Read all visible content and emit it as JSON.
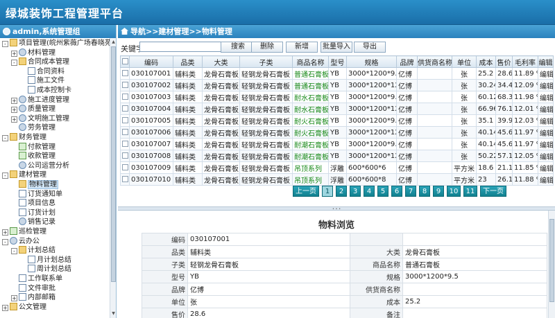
{
  "app": {
    "title": "绿城装饰工程管理平台"
  },
  "sidebar": {
    "user_label": "admin,系统管理组",
    "tree": [
      {
        "label": "项目管理(皖州紫薇广场春晓苑...",
        "level": 0,
        "tog": "-",
        "icon": "folder"
      },
      {
        "label": "材料管理",
        "level": 1,
        "tog": "+",
        "icon": "gear"
      },
      {
        "label": "合同成本管理",
        "level": 1,
        "tog": "-",
        "icon": "folder"
      },
      {
        "label": "合同资料",
        "level": 2,
        "tog": "",
        "icon": "doc"
      },
      {
        "label": "施工文件",
        "level": 2,
        "tog": "",
        "icon": "doc"
      },
      {
        "label": "成本控制卡",
        "level": 2,
        "tog": "",
        "icon": "doc"
      },
      {
        "label": "施工进度管理",
        "level": 1,
        "tog": "+",
        "icon": "gear"
      },
      {
        "label": "质量管理",
        "level": 1,
        "tog": "+",
        "icon": "gear"
      },
      {
        "label": "文明施工管理",
        "level": 1,
        "tog": "+",
        "icon": "gear"
      },
      {
        "label": "劳务管理",
        "level": 1,
        "tog": "",
        "icon": "gear"
      },
      {
        "label": "财务管理",
        "level": 0,
        "tog": "-",
        "icon": "folder"
      },
      {
        "label": "付款管理",
        "level": 1,
        "tog": "",
        "icon": "check"
      },
      {
        "label": "收款管理",
        "level": 1,
        "tog": "",
        "icon": "check"
      },
      {
        "label": "公司运营分析",
        "level": 1,
        "tog": "",
        "icon": "gear"
      },
      {
        "label": "建材管理",
        "level": 0,
        "tog": "-",
        "icon": "folder"
      },
      {
        "label": "物料管理",
        "level": 1,
        "tog": "",
        "icon": "folder",
        "selected": true
      },
      {
        "label": "订货通知单",
        "level": 1,
        "tog": "",
        "icon": "doc"
      },
      {
        "label": "项目信息",
        "level": 1,
        "tog": "",
        "icon": "doc"
      },
      {
        "label": "订货计划",
        "level": 1,
        "tog": "",
        "icon": "doc"
      },
      {
        "label": "销售记录",
        "level": 1,
        "tog": "",
        "icon": "gear"
      },
      {
        "label": "巡检管理",
        "level": 0,
        "tog": "+",
        "icon": "check"
      },
      {
        "label": "云办公",
        "level": 0,
        "tog": "-",
        "icon": "gear"
      },
      {
        "label": "计划总结",
        "level": 1,
        "tog": "-",
        "icon": "folder"
      },
      {
        "label": "月计划总结",
        "level": 2,
        "tog": "",
        "icon": "doc"
      },
      {
        "label": "周计划总结",
        "level": 2,
        "tog": "",
        "icon": "doc"
      },
      {
        "label": "工作联系单",
        "level": 1,
        "tog": "",
        "icon": "doc"
      },
      {
        "label": "文件审批",
        "level": 1,
        "tog": "",
        "icon": "doc"
      },
      {
        "label": "内部邮箱",
        "level": 1,
        "tog": "+",
        "icon": "doc"
      },
      {
        "label": "公文管理",
        "level": 0,
        "tog": "+",
        "icon": "folder"
      }
    ]
  },
  "breadcrumb": "导航>>建材管理>>物料管理",
  "toolbar": {
    "keyword_label": "关键字",
    "keyword_value": "",
    "search": "搜索",
    "delete": "删除",
    "add": "新增",
    "import": "批量导入",
    "export": "导出"
  },
  "table": {
    "headers": [
      "编码",
      "品类",
      "大类",
      "子类",
      "商品名称",
      "型号",
      "规格",
      "品牌",
      "供货商名称",
      "单位",
      "成本",
      "售价",
      "毛利率",
      "编辑"
    ],
    "rows": [
      [
        "030107001",
        "辅料类",
        "龙骨石膏板",
        "轻钢龙骨石膏板",
        "普通石膏板",
        "YB",
        "3000*1200*9.5",
        "亿博",
        "",
        "张",
        "25.2",
        "28.6",
        "11.89 %",
        "编辑"
      ],
      [
        "030107002",
        "辅料类",
        "龙骨石膏板",
        "轻钢龙骨石膏板",
        "普通石膏板",
        "YB",
        "3000*1200*12",
        "亿博",
        "",
        "张",
        "30.24",
        "34.4",
        "12.09 %",
        "编辑"
      ],
      [
        "030107003",
        "辅料类",
        "龙骨石膏板",
        "轻钢龙骨石膏板",
        "耐水石膏板",
        "YB",
        "3000*1200*9.5",
        "亿博",
        "",
        "张",
        "60.12",
        "68.3",
        "11.98 %",
        "编辑"
      ],
      [
        "030107004",
        "辅料类",
        "龙骨石膏板",
        "轻钢龙骨石膏板",
        "耐水石膏板",
        "YB",
        "3000*1200*12",
        "亿博",
        "",
        "张",
        "66.96",
        "76.1",
        "12.01 %",
        "编辑"
      ],
      [
        "030107005",
        "辅料类",
        "龙骨石膏板",
        "轻钢龙骨石膏板",
        "耐火石膏板",
        "YB",
        "3000*1200*9.5",
        "亿博",
        "",
        "张",
        "35.1",
        "39.9",
        "12.03 %",
        "编辑"
      ],
      [
        "030107006",
        "辅料类",
        "龙骨石膏板",
        "轻钢龙骨石膏板",
        "耐火石膏板",
        "YB",
        "3000*1200*12",
        "亿博",
        "",
        "张",
        "40.14",
        "45.6",
        "11.97 %",
        "编辑"
      ],
      [
        "030107007",
        "辅料类",
        "龙骨石膏板",
        "轻钢龙骨石膏板",
        "耐潮石膏板",
        "YB",
        "3000*1200*9.5",
        "亿博",
        "",
        "张",
        "40.14",
        "45.6",
        "11.97 %",
        "编辑"
      ],
      [
        "030107008",
        "辅料类",
        "龙骨石膏板",
        "轻钢龙骨石膏板",
        "耐潮石膏板",
        "YB",
        "3000*1200*12",
        "亿博",
        "",
        "张",
        "50.22",
        "57.1",
        "12.05 %",
        "编辑"
      ],
      [
        "030107009",
        "辅料类",
        "龙骨石膏板",
        "轻钢龙骨石膏板",
        "吊顶系列",
        "浮雕",
        "600*600*6",
        "亿博",
        "",
        "平方米",
        "18.6",
        "21.1",
        "11.85 %",
        "编辑"
      ],
      [
        "030107010",
        "辅料类",
        "龙骨石膏板",
        "轻钢龙骨石膏板",
        "吊顶系列",
        "浮雕",
        "600*600*8",
        "亿博",
        "",
        "平方米",
        "23",
        "26.1",
        "11.88 %",
        "编辑"
      ]
    ]
  },
  "pager": {
    "prev": "上一页",
    "pages": [
      "1",
      "2",
      "3",
      "4",
      "5",
      "6",
      "7",
      "8",
      "9",
      "10",
      "11"
    ],
    "current": "1",
    "next": "下一页"
  },
  "detail": {
    "title": "物料浏览",
    "rows": [
      [
        "编码",
        "030107001",
        "",
        ""
      ],
      [
        "品类",
        "辅料类",
        "大类",
        "龙骨石膏板"
      ],
      [
        "子类",
        "轻钢龙骨石膏板",
        "商品名称",
        "普通石膏板"
      ],
      [
        "型号",
        "YB",
        "规格",
        "3000*1200*9.5"
      ],
      [
        "品牌",
        "亿博",
        "供货商名称",
        ""
      ],
      [
        "单位",
        "张",
        "成本",
        "25.2"
      ],
      [
        "售价",
        "28.6",
        "备注",
        ""
      ]
    ]
  }
}
